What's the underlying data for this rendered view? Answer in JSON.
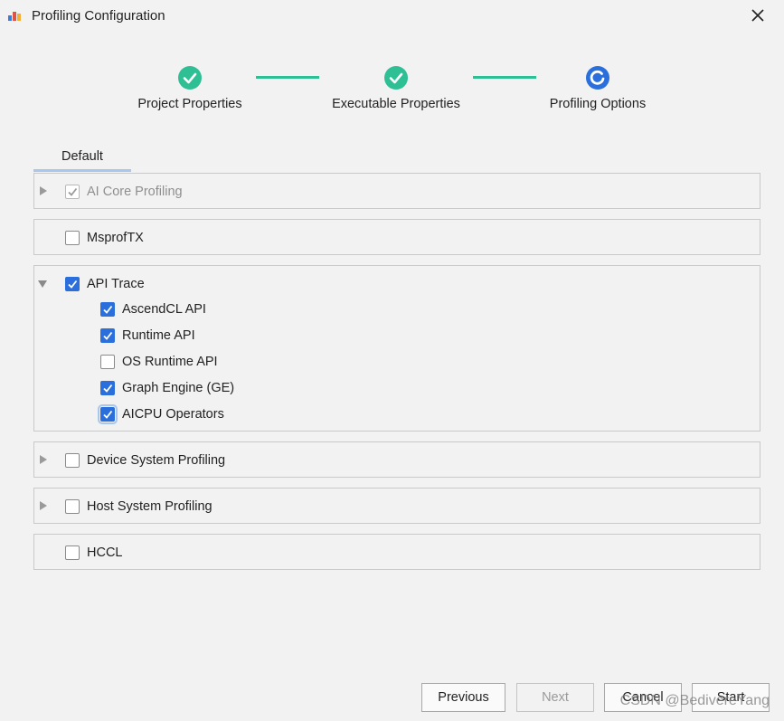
{
  "window": {
    "title": "Profiling Configuration"
  },
  "icons": {
    "app": "chart-app-icon",
    "close": "close-icon",
    "step_done": "check-circle-icon",
    "step_current": "progress-circle-icon",
    "expand": "triangle-right-icon",
    "collapse": "triangle-down-icon"
  },
  "colors": {
    "step_done": "#2ebf94",
    "step_current": "#2a6fdb",
    "checkbox": "#2a6fdb",
    "tab_underline": "#a9c7ec"
  },
  "stepper": {
    "steps": [
      {
        "label": "Project Properties",
        "status": "done"
      },
      {
        "label": "Executable Properties",
        "status": "done"
      },
      {
        "label": "Profiling Options",
        "status": "current"
      }
    ]
  },
  "tabs": [
    {
      "label": "Default",
      "selected": true
    }
  ],
  "options": {
    "ai_core": {
      "label": "AI Core Profiling",
      "checked": true,
      "disabled": true,
      "expanded": false
    },
    "msproftx": {
      "label": "MsprofTX",
      "checked": false
    },
    "api_trace": {
      "label": "API Trace",
      "checked": true,
      "expanded": true,
      "children": [
        {
          "label": "AscendCL API",
          "checked": true
        },
        {
          "label": "Runtime API",
          "checked": true
        },
        {
          "label": "OS Runtime API",
          "checked": false
        },
        {
          "label": "Graph Engine (GE)",
          "checked": true
        },
        {
          "label": "AICPU Operators",
          "checked": true
        }
      ]
    },
    "device_system": {
      "label": "Device System Profiling",
      "checked": false,
      "expanded": false
    },
    "host_system": {
      "label": "Host System Profiling",
      "checked": false,
      "expanded": false
    },
    "hccl": {
      "label": "HCCL",
      "checked": false
    }
  },
  "footer": {
    "previous": "Previous",
    "next": "Next",
    "cancel": "Cancel",
    "start": "Start"
  },
  "watermark": "CSDN @BedivereYang"
}
